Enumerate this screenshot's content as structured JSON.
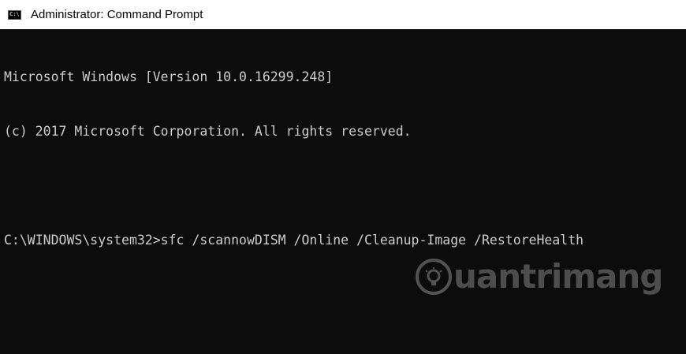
{
  "window": {
    "title": "Administrator: Command Prompt",
    "icon": "cmd-icon",
    "icon_label": "C:\\"
  },
  "console": {
    "lines": [
      "Microsoft Windows [Version 10.0.16299.248]",
      "(c) 2017 Microsoft Corporation. All rights reserved.",
      "",
      "C:\\WINDOWS\\system32>sfc /scannowDISM /Online /Cleanup-Image /RestoreHealth"
    ],
    "background": "#0c0c0c",
    "foreground": "#cccccc"
  },
  "watermark": {
    "text": "uantrimang",
    "icon": "lightbulb-icon"
  }
}
